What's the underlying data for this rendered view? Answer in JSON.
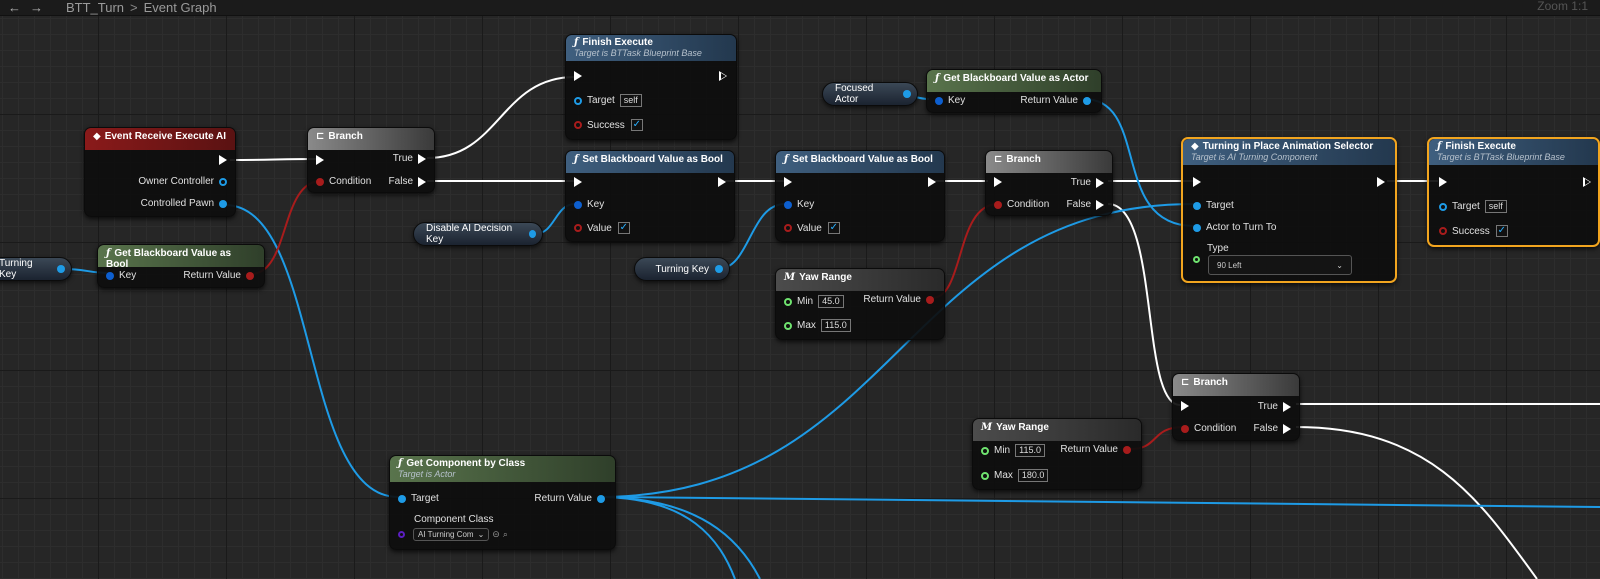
{
  "topbar": {
    "back": "←",
    "forward": "→",
    "breadcrumb": [
      "BTT_Turn",
      "Event Graph"
    ],
    "separator": ">",
    "zoom": "Zoom 1:1"
  },
  "nodes": {
    "event_receive": {
      "title": "Event Receive Execute AI",
      "owner": "Owner Controller",
      "pawn": "Controlled Pawn"
    },
    "branch1": {
      "title": "Branch",
      "condition": "Condition",
      "true": "True",
      "false": "False"
    },
    "finish1": {
      "title": "Finish Execute",
      "subtitle": "Target is BTTask Blueprint Base",
      "target": "Target",
      "target_val": "self",
      "success": "Success",
      "success_checked": "✓"
    },
    "setbb1": {
      "title": "Set Blackboard Value as Bool",
      "key": "Key",
      "value": "Value",
      "value_checked": "✓"
    },
    "setbb2": {
      "title": "Set Blackboard Value as Bool",
      "key": "Key",
      "value": "Value",
      "value_checked": "✓"
    },
    "getbb_bool": {
      "title": "Get Blackboard Value as Bool",
      "key": "Key",
      "ret": "Return Value"
    },
    "getbb_actor": {
      "title": "Get Blackboard Value as Actor",
      "key": "Key",
      "ret": "Return Value"
    },
    "branch2": {
      "title": "Branch",
      "condition": "Condition",
      "true": "True",
      "false": "False"
    },
    "yaw1": {
      "title": "Yaw Range",
      "min": "Min",
      "min_val": "45.0",
      "max": "Max",
      "max_val": "115.0",
      "ret": "Return Value"
    },
    "turning_selector": {
      "title": "Turning in Place Animation Selector",
      "subtitle": "Target is AI Turning Component",
      "target": "Target",
      "actor": "Actor to Turn To",
      "type": "Type",
      "type_val": "90 Left"
    },
    "finish2": {
      "title": "Finish Execute",
      "subtitle": "Target is BTTask Blueprint Base",
      "target": "Target",
      "target_val": "self",
      "success": "Success",
      "success_checked": "✓"
    },
    "branch3": {
      "title": "Branch",
      "condition": "Condition",
      "true": "True",
      "false": "False"
    },
    "yaw2": {
      "title": "Yaw Range",
      "min": "Min",
      "min_val": "115.0",
      "max": "Max",
      "max_val": "180.0",
      "ret": "Return Value"
    },
    "getcomp": {
      "title": "Get Component by Class",
      "subtitle": "Target is Actor",
      "target": "Target",
      "ret": "Return Value",
      "compclass": "Component Class",
      "compclass_val": "AI Turning Com"
    }
  },
  "variables": {
    "turning_key_left": "Turning Key",
    "focused_actor": "Focused Actor",
    "disable_ai": "Disable AI Decision Key",
    "turning_key_mid": "Turning Key"
  },
  "icons": {
    "function": "ƒ",
    "macro": "M",
    "branch": "⊏",
    "event": "◆",
    "chevron": "⌄",
    "check": "✓"
  },
  "colors": {
    "exec": "#ffffff",
    "object": "#1e9be6",
    "bool": "#a81c1c",
    "float": "#6fe36f",
    "class": "#5b1ec0",
    "selected": "#f2a51f"
  }
}
